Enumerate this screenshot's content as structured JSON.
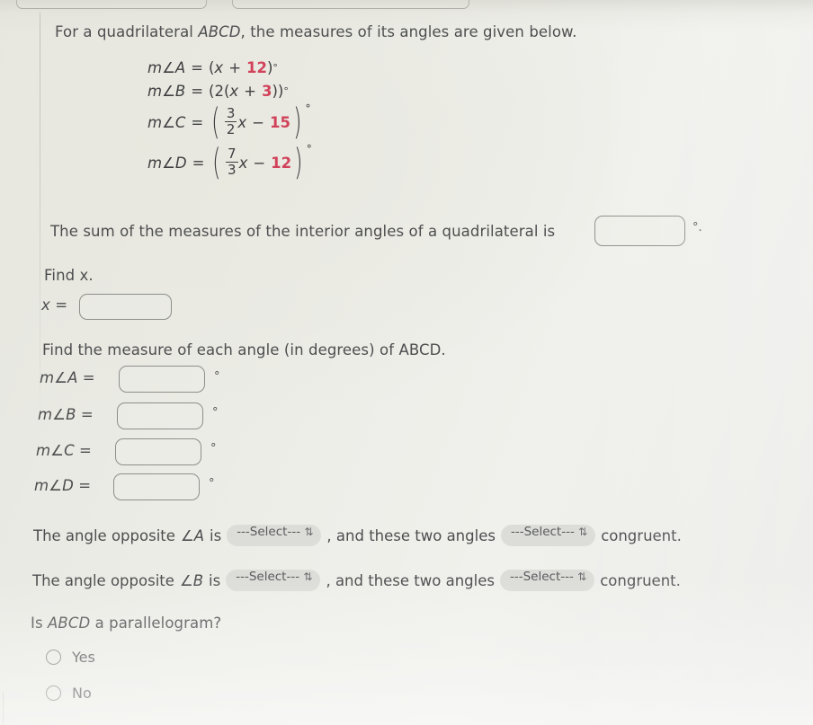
{
  "intro": {
    "text_before_abcd": "For a quadrilateral ",
    "abcd": "ABCD",
    "text_after_abcd": ", the measures of its angles are given below."
  },
  "equations": [
    {
      "lhs": "m∠A",
      "eq": "=",
      "form": "simple",
      "open_paren": "(",
      "var": "x",
      "operator": "+",
      "constant": "12",
      "close_paren": ")",
      "degree": "°"
    },
    {
      "lhs": "m∠B",
      "eq": "=",
      "form": "simple_coefficient",
      "open_paren": "(",
      "coefficient": "2",
      "inner_open": "(",
      "var": "x",
      "operator": "+",
      "constant": "3",
      "inner_close": ")",
      "close_paren": ")",
      "degree": "°"
    },
    {
      "lhs": "m∠C",
      "eq": "=",
      "form": "fraction",
      "open_paren": "(",
      "numerator": "3",
      "denominator": "2",
      "var": "x",
      "operator": "−",
      "constant": "15",
      "close_paren": ")",
      "degree": "°"
    },
    {
      "lhs": "m∠D",
      "eq": "=",
      "form": "fraction",
      "open_paren": "(",
      "numerator": "7",
      "denominator": "3",
      "var": "x",
      "operator": "−",
      "constant": "12",
      "close_paren": ")",
      "degree": "°"
    }
  ],
  "sum_question": {
    "text": "The sum of the measures of the interior angles of a quadrilateral is",
    "input_value": "",
    "degree_suffix": "°."
  },
  "find_x": {
    "label": "Find x.",
    "x_label": "x =",
    "input_value": ""
  },
  "find_angles": {
    "label": "Find the measure of each angle (in degrees) of ABCD.",
    "rows": [
      {
        "label": "m∠A  =",
        "value": "",
        "degree": "°"
      },
      {
        "label": "m∠B  =",
        "value": "",
        "degree": "°"
      },
      {
        "label": "m∠C  =",
        "value": "",
        "degree": "°"
      },
      {
        "label": "m∠D  =",
        "value": "",
        "degree": "°"
      }
    ]
  },
  "opposite_statements": [
    {
      "lead": "The angle opposite",
      "angle": "∠A",
      "is_word": "is",
      "select1": "---Select---",
      "mid": ", and these two angles",
      "select2": "---Select---",
      "tail": "congruent."
    },
    {
      "lead": "The angle opposite",
      "angle": "∠B",
      "is_word": "is",
      "select1": "---Select---",
      "mid": ", and these two angles",
      "select2": "---Select---",
      "tail": "congruent."
    }
  ],
  "parallelogram_question": {
    "text_before": "Is ",
    "abcd": "ABCD",
    "text_after": " a parallelogram?",
    "options": [
      {
        "label": "Yes",
        "selected": false
      },
      {
        "label": "No",
        "selected": false
      }
    ]
  },
  "icons": {
    "select_chevron": "⇅"
  },
  "colors": {
    "page_background": "#ecece7",
    "text": "#4d4d4f",
    "highlight_number": "#d1425a",
    "input_border": "#8e8e8b",
    "select_background": "#dcdcd8"
  }
}
